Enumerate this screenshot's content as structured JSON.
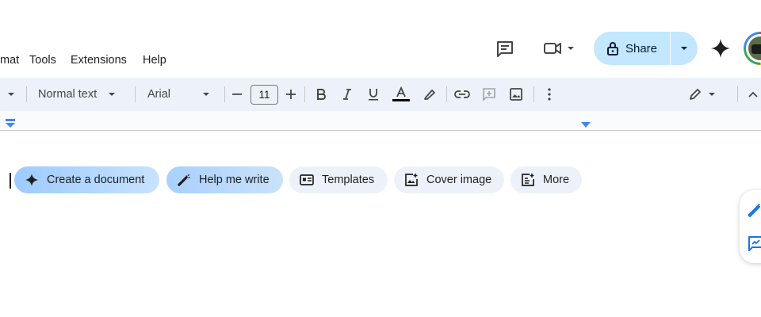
{
  "menu": {
    "items": [
      {
        "label": "mat",
        "full": "Format"
      },
      {
        "label": "Tools"
      },
      {
        "label": "Extensions"
      },
      {
        "label": "Help"
      }
    ]
  },
  "header": {
    "share_label": "Share",
    "icons": [
      "comment-history-icon",
      "meet-video-icon",
      "gemini-sparkle-icon"
    ]
  },
  "toolbar": {
    "style_value": "Normal text",
    "font_value": "Arial",
    "font_size": "11",
    "decrease_label": "−",
    "increase_label": "+"
  },
  "chips": [
    {
      "label": "Create a document",
      "icon": "sparkle-icon"
    },
    {
      "label": "Help me write",
      "icon": "magic-pen-icon"
    },
    {
      "label": "Templates",
      "icon": "templates-icon"
    },
    {
      "label": "Cover image",
      "icon": "cover-image-icon"
    },
    {
      "label": "More",
      "icon": "more-add-icon"
    }
  ],
  "colors": {
    "toolbar_bg": "#edf2fa",
    "share_bg": "#c2e7ff",
    "ruler_marker": "#4285f4",
    "chip_blue": "#9ecbff",
    "chip_grey": "#edf2fa"
  }
}
